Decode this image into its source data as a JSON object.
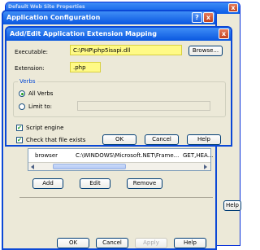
{
  "colors": {
    "title_blue": "#0a5ce8",
    "dialog_bg": "#ece9d8",
    "highlight": "#fffa86",
    "close_red": "#d65a34"
  },
  "bg_window": {
    "title": "Default Web Site Properties",
    "close": "x",
    "help_btn": "Help"
  },
  "app_config": {
    "title": "Application Configuration",
    "help_glyph": "?",
    "close": "x",
    "list_row": {
      "extension": "browser",
      "path": "C:\\WINDOWS\\Microsoft.NET\\Frame...",
      "verbs": "GET,HEA..."
    },
    "buttons": {
      "add": "Add",
      "edit": "Edit",
      "remove": "Remove"
    },
    "footer": {
      "ok": "OK",
      "cancel": "Cancel",
      "apply": "Apply",
      "help": "Help"
    }
  },
  "mapping": {
    "title": "Add/Edit Application Extension Mapping",
    "close": "x",
    "executable_label": "Executable:",
    "executable_value": "C:\\PHP\\php5isapi.dll",
    "browse_label": "Browse...",
    "extension_label": "Extension:",
    "extension_value": ".php",
    "verbs_label": "Verbs",
    "all_verbs_label": "All Verbs",
    "limit_to_label": "Limit to:",
    "script_engine_label": "Script engine",
    "check_file_label": "Check that file exists",
    "ok": "OK",
    "cancel": "Cancel",
    "help": "Help"
  }
}
